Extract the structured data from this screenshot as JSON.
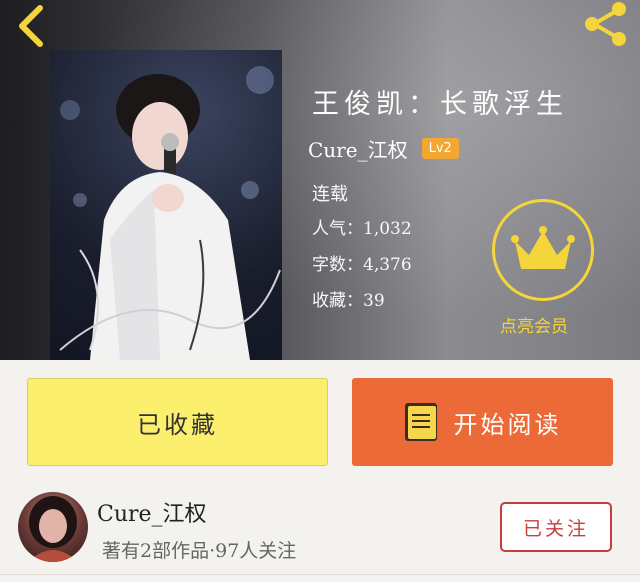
{
  "header": {
    "back_icon": "chevron-left-icon",
    "share_icon": "share-icon",
    "accent": "#f5d53c"
  },
  "book": {
    "title": "王俊凯：长歌浮生",
    "author": "Cure_江权",
    "level": "Lv2",
    "status": "连载",
    "popularity": "人气：1,032",
    "word_count": "字数：4,376",
    "favorites": "收藏：39"
  },
  "vip": {
    "icon": "crown-icon",
    "label": "点亮会员"
  },
  "actions": {
    "collected_label": "已收藏",
    "read_label": "开始阅读",
    "read_icon": "book-icon",
    "collected_color": "#fbef6d",
    "read_color": "#ec6a38"
  },
  "author_card": {
    "name": "Cure_江权",
    "meta": "著有2部作品·97人关注",
    "follow_label": "已关注"
  }
}
